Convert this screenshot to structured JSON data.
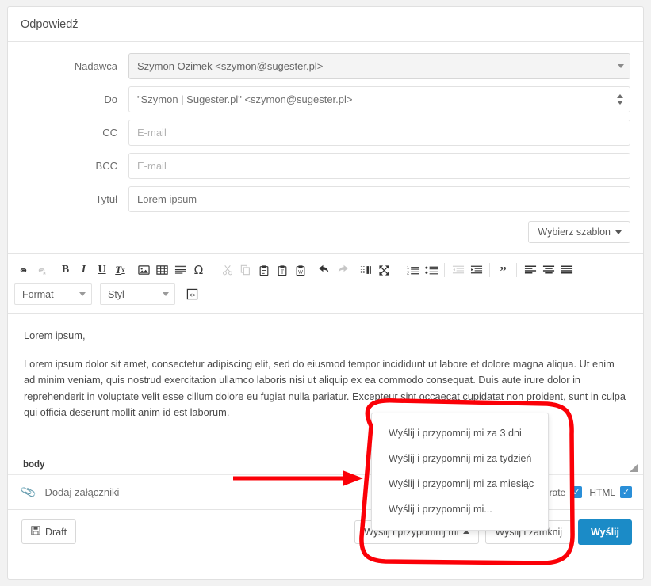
{
  "panel": {
    "title": "Odpowiedź"
  },
  "form": {
    "fields": [
      {
        "label": "Nadawca",
        "value": "Szymon Ozimek <szymon@sugester.pl>",
        "placeholder": "",
        "type": "select-button"
      },
      {
        "label": "Do",
        "value": "\"Szymon | Sugester.pl\" <szymon@sugester.pl>",
        "placeholder": "",
        "type": "select"
      },
      {
        "label": "CC",
        "value": "",
        "placeholder": "E-mail",
        "type": "text"
      },
      {
        "label": "BCC",
        "value": "",
        "placeholder": "E-mail",
        "type": "text"
      },
      {
        "label": "Tytuł",
        "value": "Lorem ipsum",
        "placeholder": "",
        "type": "text"
      }
    ],
    "template_button": "Wybierz szablon"
  },
  "editor": {
    "toolbar_row1": [
      {
        "name": "link-icon",
        "glyph": "🔗",
        "disabled": false
      },
      {
        "name": "unlink-icon",
        "glyph": "🔗",
        "disabled": true
      },
      {
        "name": "bold-icon",
        "glyph": "B",
        "disabled": false
      },
      {
        "name": "italic-icon",
        "glyph": "I",
        "disabled": false
      },
      {
        "name": "underline-icon",
        "glyph": "U",
        "disabled": false
      },
      {
        "name": "remove-format-icon",
        "glyph": "Tx",
        "disabled": false
      },
      {
        "name": "image-icon",
        "glyph": "image",
        "disabled": false
      },
      {
        "name": "table-icon",
        "glyph": "table",
        "disabled": false
      },
      {
        "name": "horizontal-rule-icon",
        "glyph": "hr",
        "disabled": false
      },
      {
        "name": "special-character-icon",
        "glyph": "Ω",
        "disabled": false
      },
      {
        "name": "cut-icon",
        "glyph": "✂",
        "disabled": true
      },
      {
        "name": "copy-icon",
        "glyph": "copy",
        "disabled": true
      },
      {
        "name": "paste-icon",
        "glyph": "paste",
        "disabled": false
      },
      {
        "name": "paste-as-text-icon",
        "glyph": "pasteT",
        "disabled": false
      },
      {
        "name": "paste-from-word-icon",
        "glyph": "pasteW",
        "disabled": false
      },
      {
        "name": "undo-icon",
        "glyph": "undo",
        "disabled": false
      },
      {
        "name": "redo-icon",
        "glyph": "redo",
        "disabled": true
      },
      {
        "name": "page-break-icon",
        "glyph": "pbreak",
        "disabled": false
      },
      {
        "name": "maximize-icon",
        "glyph": "max",
        "disabled": false
      },
      {
        "name": "numbered-list-icon",
        "glyph": "ol",
        "disabled": false
      },
      {
        "name": "bulleted-list-icon",
        "glyph": "ul",
        "disabled": false
      },
      {
        "name": "outdent-icon",
        "glyph": "outdent",
        "disabled": true
      },
      {
        "name": "indent-icon",
        "glyph": "indent",
        "disabled": false
      },
      {
        "name": "blockquote-icon",
        "glyph": "”",
        "disabled": false
      },
      {
        "name": "align-left-icon",
        "glyph": "al",
        "disabled": false
      },
      {
        "name": "align-center-icon",
        "glyph": "ac",
        "disabled": false
      },
      {
        "name": "justify-icon",
        "glyph": "aj",
        "disabled": false
      }
    ],
    "format_select": "Format",
    "style_select": "Styl",
    "source_button": "source-icon",
    "body_paragraphs": [
      "Lorem ipsum,",
      "Lorem ipsum dolor sit amet, consectetur adipiscing elit, sed do eiusmod tempor incididunt ut labore et dolore magna aliqua. Ut enim ad minim veniam, quis nostrud exercitation ullamco laboris nisi ut aliquip ex ea commodo consequat. Duis aute irure dolor in reprehenderit in voluptate velit esse cillum dolore eu fugiat nulla pariatur. Excepteur sint occaecat cupidatat non proident, sunt in culpa qui officia deserunt mollit anim id est laborum."
    ],
    "status_tag": "body"
  },
  "attachments": {
    "label": "Dodaj załączniki",
    "options": [
      {
        "label": "st rate",
        "checked": true
      },
      {
        "label": "HTML",
        "checked": true
      }
    ]
  },
  "footer": {
    "draft_button": "Draft",
    "remind_button": "Wyślij i przypomnij mi",
    "send_close_button": "Wyślij i zamknij",
    "send_button": "Wyślij"
  },
  "dropdown": {
    "items": [
      "Wyślij i przypomnij mi za 3 dni",
      "Wyślij i przypomnij mi za tydzień",
      "Wyślij i przypomnij mi za miesiąc",
      "Wyślij i przypomnij mi..."
    ]
  },
  "colors": {
    "accent": "#1b8bc7",
    "annotation": "#fb0007",
    "checkbox": "#2a8fd8"
  }
}
